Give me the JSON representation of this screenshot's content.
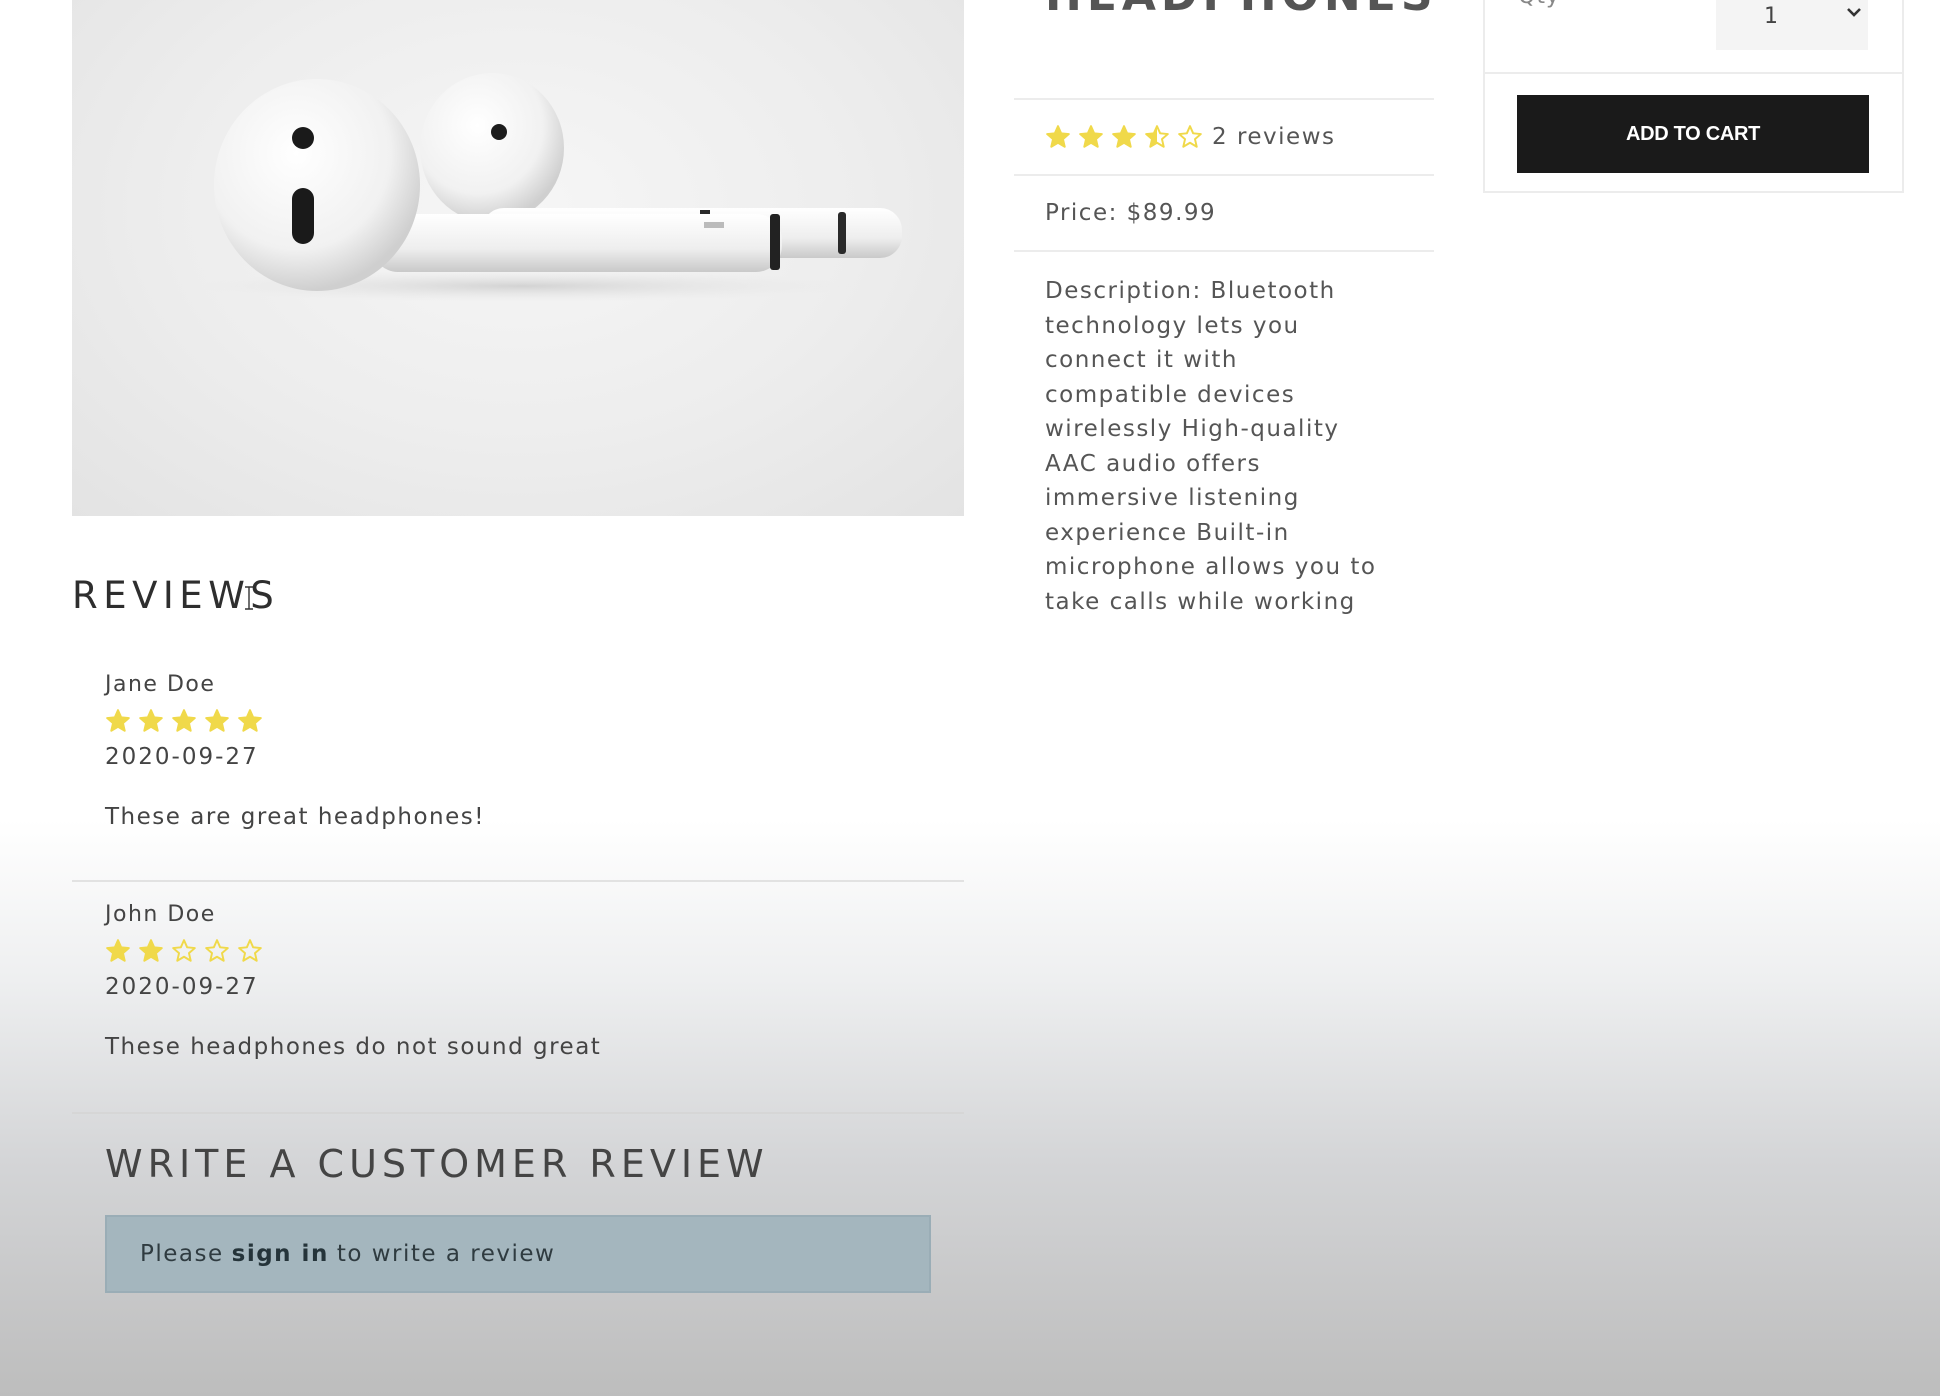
{
  "product": {
    "title": "HEADPHONES",
    "rating": 3.5,
    "rating_max": 5,
    "reviews_count_label": "2 reviews",
    "price_label": "Price: $89.99",
    "description": "Description: Bluetooth technology lets you connect it with compatible devices wirelessly High-quality AAC audio offers immersive listening experience Built-in microphone allows you to take calls while working"
  },
  "cart": {
    "qty_label": "Qty",
    "qty_value": "1",
    "add_to_cart_label": "ADD TO CART"
  },
  "reviews": {
    "heading": "REVIEWS",
    "items": [
      {
        "name": "Jane Doe",
        "rating": 5,
        "date": "2020-09-27",
        "comment": "These are great headphones!"
      },
      {
        "name": "John Doe",
        "rating": 2,
        "date": "2020-09-27",
        "comment": "These headphones do not sound great"
      }
    ]
  },
  "write_review": {
    "heading": "WRITE A CUSTOMER REVIEW",
    "prefix": "Please",
    "link_text": "sign in",
    "suffix": "to write a review"
  },
  "colors": {
    "star": "#f0d94a",
    "star_empty_stroke": "#f0d94a",
    "button_bg": "#1a1a1a",
    "alert_bg": "#a4b6be"
  }
}
